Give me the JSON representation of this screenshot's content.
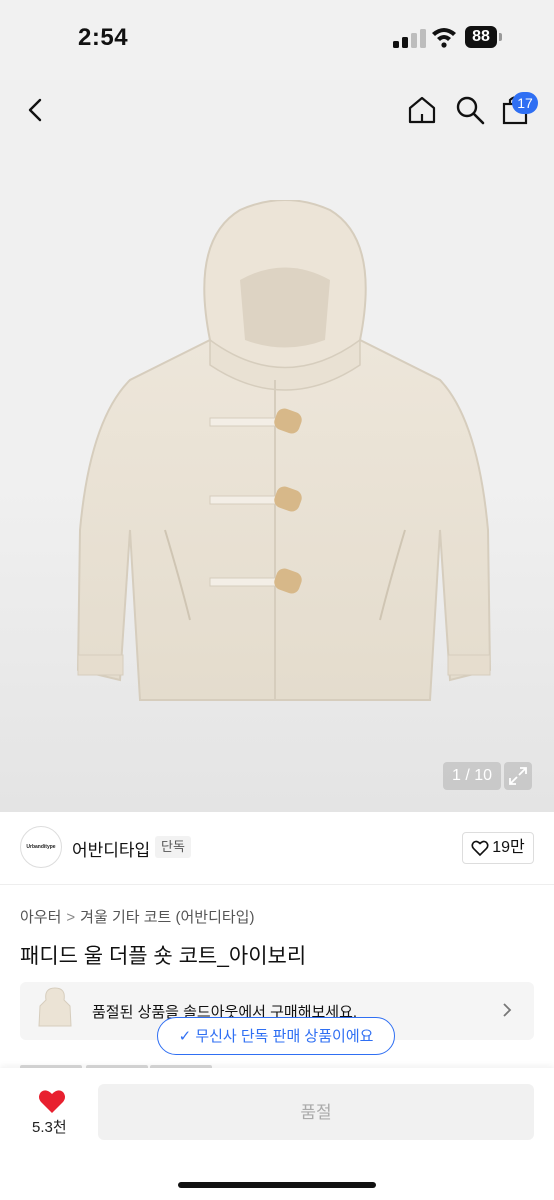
{
  "status_bar": {
    "time": "2:54",
    "battery": "88"
  },
  "header": {
    "cart_count": "17"
  },
  "gallery": {
    "pager": "1 / 10"
  },
  "brand": {
    "logo_text": "Urbanditype",
    "name": "어반디타입",
    "tag": "단독",
    "likes": "19만"
  },
  "breadcrumb": {
    "category": "아우터",
    "subcategory": "겨울 기타 코트 (어반디타입)"
  },
  "product": {
    "title": "패디드 울 더플 숏 코트_아이보리"
  },
  "soldout_banner": {
    "text": "품절된 상품을 솔드아웃에서 구매해보세요."
  },
  "exclusive_pill": {
    "text": "무신사 단독 판매 상품이에요"
  },
  "bottom_bar": {
    "wish_count": "5.3천",
    "buy_label": "품절"
  },
  "colors": {
    "accent": "#2f6ff3",
    "heart": "#e8202f"
  }
}
